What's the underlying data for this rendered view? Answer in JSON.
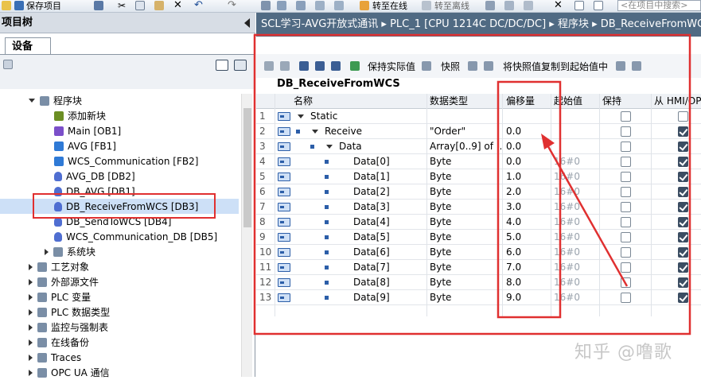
{
  "toolbar": {
    "save_project": "保存项目",
    "go_online": "转至在线",
    "go_offline": "转至离线",
    "search_placeholder": "<在项目中搜索>"
  },
  "left_pane": {
    "title": "项目树",
    "tab_devices": "设备",
    "tree": [
      {
        "label": "程序块",
        "kind": "folder-open"
      },
      {
        "label": "添加新块",
        "kind": "add"
      },
      {
        "label": "Main [OB1]",
        "kind": "ob"
      },
      {
        "label": "AVG [FB1]",
        "kind": "fb"
      },
      {
        "label": "WCS_Communication [FB2]",
        "kind": "fb"
      },
      {
        "label": "AVG_DB [DB2]",
        "kind": "db"
      },
      {
        "label": "DB_AVG [DB1]",
        "kind": "db"
      },
      {
        "label": "DB_ReceiveFromWCS [DB3]",
        "kind": "db",
        "selected": true
      },
      {
        "label": "DB_SendToWCS [DB4]",
        "kind": "db"
      },
      {
        "label": "WCS_Communication_DB [DB5]",
        "kind": "db"
      },
      {
        "label": "系统块",
        "kind": "folder"
      },
      {
        "label": "工艺对象",
        "kind": "folder"
      },
      {
        "label": "外部源文件",
        "kind": "folder"
      },
      {
        "label": "PLC 变量",
        "kind": "folder"
      },
      {
        "label": "PLC 数据类型",
        "kind": "folder"
      },
      {
        "label": "监控与强制表",
        "kind": "folder"
      },
      {
        "label": "在线备份",
        "kind": "folder"
      },
      {
        "label": "Traces",
        "kind": "folder"
      },
      {
        "label": "OPC UA 通信",
        "kind": "folder"
      }
    ]
  },
  "right_pane": {
    "breadcrumb": "SCL学习-AVG开放式通讯 ▸ PLC_1 [CPU 1214C DC/DC/DC] ▸ 程序块 ▸ DB_ReceiveFromWCS",
    "tool_keep_actual": "保持实际值",
    "tool_snapshot": "快照",
    "tool_copy_snapshot": "将快照值复制到起始值中",
    "db_title": "DB_ReceiveFromWCS",
    "columns": {
      "name": "名称",
      "datatype": "数据类型",
      "offset": "偏移量",
      "start": "起始值",
      "retain": "保持",
      "hmi": "从 HMI/OPC..."
    },
    "rows": [
      {
        "num": "1",
        "name": "Static",
        "type": "",
        "offset": "",
        "start": "",
        "retain": false,
        "hmi": false,
        "level": 0
      },
      {
        "num": "2",
        "name": "Receive",
        "type": "\"Order\"",
        "offset": "0.0",
        "start": "",
        "retain": false,
        "hmi": true,
        "level": 1
      },
      {
        "num": "3",
        "name": "Data",
        "type": "Array[0..9] of ...",
        "offset": "0.0",
        "start": "",
        "retain": false,
        "hmi": true,
        "level": 2
      },
      {
        "num": "4",
        "name": "Data[0]",
        "type": "Byte",
        "offset": "0.0",
        "start": "16#0",
        "retain": false,
        "hmi": true,
        "level": 3
      },
      {
        "num": "5",
        "name": "Data[1]",
        "type": "Byte",
        "offset": "1.0",
        "start": "16#0",
        "retain": false,
        "hmi": true,
        "level": 3
      },
      {
        "num": "6",
        "name": "Data[2]",
        "type": "Byte",
        "offset": "2.0",
        "start": "16#0",
        "retain": false,
        "hmi": true,
        "level": 3
      },
      {
        "num": "7",
        "name": "Data[3]",
        "type": "Byte",
        "offset": "3.0",
        "start": "16#0",
        "retain": false,
        "hmi": true,
        "level": 3
      },
      {
        "num": "8",
        "name": "Data[4]",
        "type": "Byte",
        "offset": "4.0",
        "start": "16#0",
        "retain": false,
        "hmi": true,
        "level": 3
      },
      {
        "num": "9",
        "name": "Data[5]",
        "type": "Byte",
        "offset": "5.0",
        "start": "16#0",
        "retain": false,
        "hmi": true,
        "level": 3
      },
      {
        "num": "10",
        "name": "Data[6]",
        "type": "Byte",
        "offset": "6.0",
        "start": "16#0",
        "retain": false,
        "hmi": true,
        "level": 3
      },
      {
        "num": "11",
        "name": "Data[7]",
        "type": "Byte",
        "offset": "7.0",
        "start": "16#0",
        "retain": false,
        "hmi": true,
        "level": 3
      },
      {
        "num": "12",
        "name": "Data[8]",
        "type": "Byte",
        "offset": "8.0",
        "start": "16#0",
        "retain": false,
        "hmi": true,
        "level": 3
      },
      {
        "num": "13",
        "name": "Data[9]",
        "type": "Byte",
        "offset": "9.0",
        "start": "16#0",
        "retain": false,
        "hmi": true,
        "level": 3
      }
    ]
  },
  "watermark": "知乎 @噜歌",
  "colors": {
    "annotation": "#e03030",
    "breadcrumb_bg": "#506a83",
    "selected_row": "#cde0f7"
  }
}
